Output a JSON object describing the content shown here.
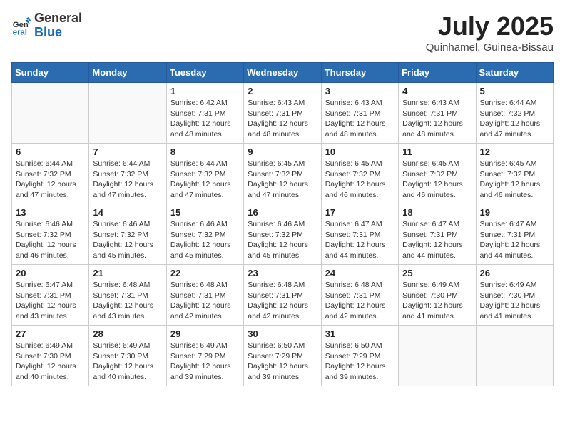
{
  "header": {
    "logo_general": "General",
    "logo_blue": "Blue",
    "month_title": "July 2025",
    "location": "Quinhamel, Guinea-Bissau"
  },
  "weekdays": [
    "Sunday",
    "Monday",
    "Tuesday",
    "Wednesday",
    "Thursday",
    "Friday",
    "Saturday"
  ],
  "weeks": [
    [
      {
        "day": "",
        "info": ""
      },
      {
        "day": "",
        "info": ""
      },
      {
        "day": "1",
        "info": "Sunrise: 6:42 AM\nSunset: 7:31 PM\nDaylight: 12 hours\nand 48 minutes."
      },
      {
        "day": "2",
        "info": "Sunrise: 6:43 AM\nSunset: 7:31 PM\nDaylight: 12 hours\nand 48 minutes."
      },
      {
        "day": "3",
        "info": "Sunrise: 6:43 AM\nSunset: 7:31 PM\nDaylight: 12 hours\nand 48 minutes."
      },
      {
        "day": "4",
        "info": "Sunrise: 6:43 AM\nSunset: 7:31 PM\nDaylight: 12 hours\nand 48 minutes."
      },
      {
        "day": "5",
        "info": "Sunrise: 6:44 AM\nSunset: 7:32 PM\nDaylight: 12 hours\nand 47 minutes."
      }
    ],
    [
      {
        "day": "6",
        "info": "Sunrise: 6:44 AM\nSunset: 7:32 PM\nDaylight: 12 hours\nand 47 minutes."
      },
      {
        "day": "7",
        "info": "Sunrise: 6:44 AM\nSunset: 7:32 PM\nDaylight: 12 hours\nand 47 minutes."
      },
      {
        "day": "8",
        "info": "Sunrise: 6:44 AM\nSunset: 7:32 PM\nDaylight: 12 hours\nand 47 minutes."
      },
      {
        "day": "9",
        "info": "Sunrise: 6:45 AM\nSunset: 7:32 PM\nDaylight: 12 hours\nand 47 minutes."
      },
      {
        "day": "10",
        "info": "Sunrise: 6:45 AM\nSunset: 7:32 PM\nDaylight: 12 hours\nand 46 minutes."
      },
      {
        "day": "11",
        "info": "Sunrise: 6:45 AM\nSunset: 7:32 PM\nDaylight: 12 hours\nand 46 minutes."
      },
      {
        "day": "12",
        "info": "Sunrise: 6:45 AM\nSunset: 7:32 PM\nDaylight: 12 hours\nand 46 minutes."
      }
    ],
    [
      {
        "day": "13",
        "info": "Sunrise: 6:46 AM\nSunset: 7:32 PM\nDaylight: 12 hours\nand 46 minutes."
      },
      {
        "day": "14",
        "info": "Sunrise: 6:46 AM\nSunset: 7:32 PM\nDaylight: 12 hours\nand 45 minutes."
      },
      {
        "day": "15",
        "info": "Sunrise: 6:46 AM\nSunset: 7:32 PM\nDaylight: 12 hours\nand 45 minutes."
      },
      {
        "day": "16",
        "info": "Sunrise: 6:46 AM\nSunset: 7:32 PM\nDaylight: 12 hours\nand 45 minutes."
      },
      {
        "day": "17",
        "info": "Sunrise: 6:47 AM\nSunset: 7:31 PM\nDaylight: 12 hours\nand 44 minutes."
      },
      {
        "day": "18",
        "info": "Sunrise: 6:47 AM\nSunset: 7:31 PM\nDaylight: 12 hours\nand 44 minutes."
      },
      {
        "day": "19",
        "info": "Sunrise: 6:47 AM\nSunset: 7:31 PM\nDaylight: 12 hours\nand 44 minutes."
      }
    ],
    [
      {
        "day": "20",
        "info": "Sunrise: 6:47 AM\nSunset: 7:31 PM\nDaylight: 12 hours\nand 43 minutes."
      },
      {
        "day": "21",
        "info": "Sunrise: 6:48 AM\nSunset: 7:31 PM\nDaylight: 12 hours\nand 43 minutes."
      },
      {
        "day": "22",
        "info": "Sunrise: 6:48 AM\nSunset: 7:31 PM\nDaylight: 12 hours\nand 42 minutes."
      },
      {
        "day": "23",
        "info": "Sunrise: 6:48 AM\nSunset: 7:31 PM\nDaylight: 12 hours\nand 42 minutes."
      },
      {
        "day": "24",
        "info": "Sunrise: 6:48 AM\nSunset: 7:31 PM\nDaylight: 12 hours\nand 42 minutes."
      },
      {
        "day": "25",
        "info": "Sunrise: 6:49 AM\nSunset: 7:30 PM\nDaylight: 12 hours\nand 41 minutes."
      },
      {
        "day": "26",
        "info": "Sunrise: 6:49 AM\nSunset: 7:30 PM\nDaylight: 12 hours\nand 41 minutes."
      }
    ],
    [
      {
        "day": "27",
        "info": "Sunrise: 6:49 AM\nSunset: 7:30 PM\nDaylight: 12 hours\nand 40 minutes."
      },
      {
        "day": "28",
        "info": "Sunrise: 6:49 AM\nSunset: 7:30 PM\nDaylight: 12 hours\nand 40 minutes."
      },
      {
        "day": "29",
        "info": "Sunrise: 6:49 AM\nSunset: 7:29 PM\nDaylight: 12 hours\nand 39 minutes."
      },
      {
        "day": "30",
        "info": "Sunrise: 6:50 AM\nSunset: 7:29 PM\nDaylight: 12 hours\nand 39 minutes."
      },
      {
        "day": "31",
        "info": "Sunrise: 6:50 AM\nSunset: 7:29 PM\nDaylight: 12 hours\nand 39 minutes."
      },
      {
        "day": "",
        "info": ""
      },
      {
        "day": "",
        "info": ""
      }
    ]
  ]
}
